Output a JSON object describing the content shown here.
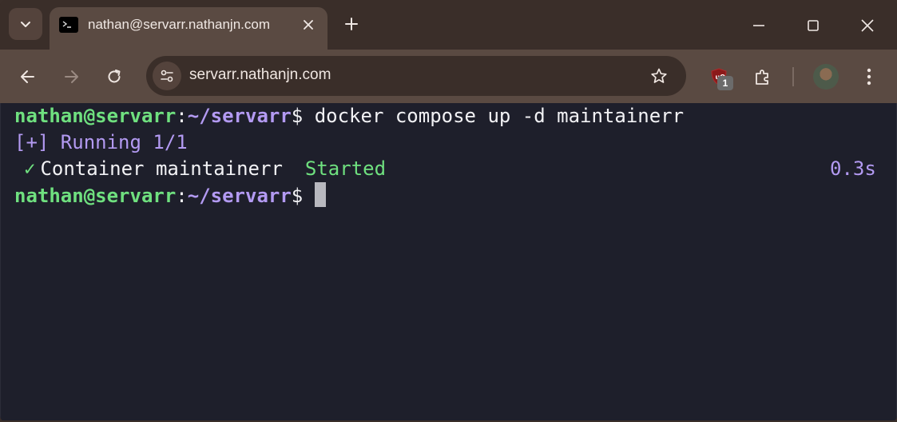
{
  "browser": {
    "tab": {
      "title": "nathan@servarr.nathanjn.com"
    },
    "omnibox": {
      "url": "servarr.nathanjn.com"
    },
    "extension_badge": "1"
  },
  "terminal": {
    "prompt_user": "nathan@servarr",
    "prompt_sep": ":",
    "prompt_path": "~/servarr",
    "prompt_sym": "$",
    "command": " docker compose up -d maintainerr",
    "status_line": "[+] Running 1/1",
    "check_mark": "✓",
    "container_text": "Container maintainerr",
    "container_status": "Started",
    "container_time": "0.3s"
  },
  "colors": {
    "prompt_user": "#6fe07f",
    "prompt_path": "#b39af2",
    "terminal_bg": "#1e1f2b",
    "chrome_frame": "#3a2e29",
    "chrome_toolbar": "#5a4a42"
  },
  "icons": [
    "chevron-down-icon",
    "terminal-favicon-icon",
    "close-icon",
    "plus-icon",
    "minimize-icon",
    "maximize-icon",
    "window-close-icon",
    "back-icon",
    "forward-icon",
    "reload-icon",
    "site-info-icon",
    "star-icon",
    "ublock-icon",
    "extensions-icon",
    "avatar",
    "kebab-menu-icon"
  ]
}
